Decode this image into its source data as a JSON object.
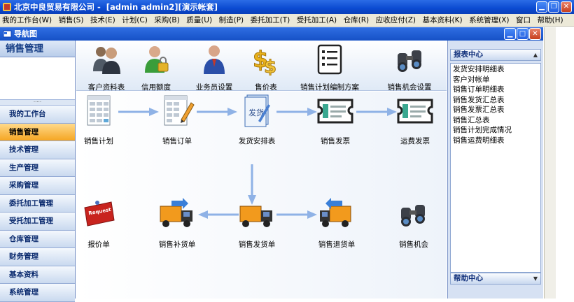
{
  "window": {
    "title": "北京中良贸易有限公司 -  [admin admin2][演示帐套]"
  },
  "menu": [
    "我的工作台(W)",
    "销售(S)",
    "技术(E)",
    "计划(C)",
    "采购(B)",
    "质量(U)",
    "制造(P)",
    "委托加工(T)",
    "受托加工(A)",
    "仓库(R)",
    "应收应付(Z)",
    "基本资料(K)",
    "系统管理(X)",
    "窗口",
    "帮助(H)"
  ],
  "nav": {
    "title": "导航图"
  },
  "left": {
    "header": "销售管理",
    "items": [
      "我的工作台",
      "销售管理",
      "技术管理",
      "生产管理",
      "采购管理",
      "委托加工管理",
      "受托加工管理",
      "仓库管理",
      "财务管理",
      "基本资料",
      "系统管理"
    ],
    "active_index": 1
  },
  "tools": [
    "客户资料表",
    "信用额度",
    "业务员设置",
    "售价表",
    "销售计划编制方案",
    "销售机会设置"
  ],
  "flow": {
    "sales_plan": "销售计划",
    "sales_order": "销售订单",
    "delivery_schedule": "发货安排表",
    "delivery_doc_icon_text": "发货",
    "sales_invoice": "销售发票",
    "freight_invoice": "运费发票",
    "quote": "报价单",
    "quote_icon_text": "Request Quote",
    "replenish": "销售补货单",
    "delivery": "销售发货单",
    "return": "销售退货单",
    "opportunity": "销售机会"
  },
  "right": {
    "report_header": "报表中心",
    "reports": [
      "发货安排明细表",
      "客户对帐单",
      "销售订单明细表",
      "销售发货汇总表",
      "销售发票汇总表",
      "销售汇总表",
      "销售计划完成情况",
      "销售运费明细表"
    ],
    "help_header": "帮助中心"
  },
  "colors": {
    "title_blue": "#0b4ad1",
    "active_orange": "#f5a623",
    "arrow_blue": "#8fb2e6"
  }
}
